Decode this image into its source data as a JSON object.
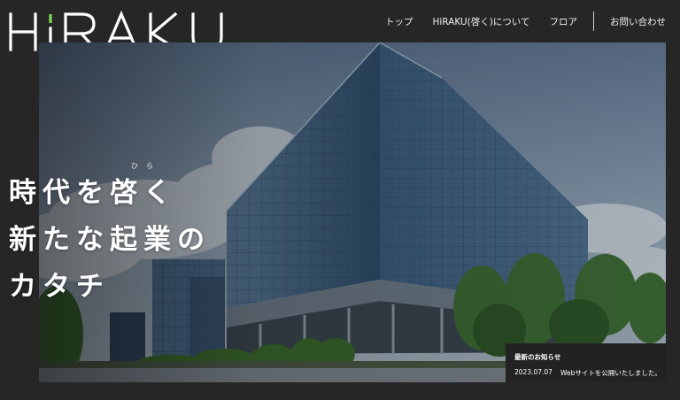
{
  "brand": {
    "logo_text": "HiRAKU",
    "accent": "#7ed957"
  },
  "nav": {
    "items": [
      "トップ",
      "HiRAKU(啓く)について",
      "フロア"
    ],
    "contact": "お問い合わせ"
  },
  "hero": {
    "ruby": "ひら",
    "lines": [
      "時代を啓く",
      "新たな起業の",
      "カタチ"
    ]
  },
  "news": {
    "heading": "最新のお知らせ",
    "items": [
      {
        "date": "2023.07.07",
        "title": "Webサイトを公開いたしました。"
      }
    ]
  }
}
